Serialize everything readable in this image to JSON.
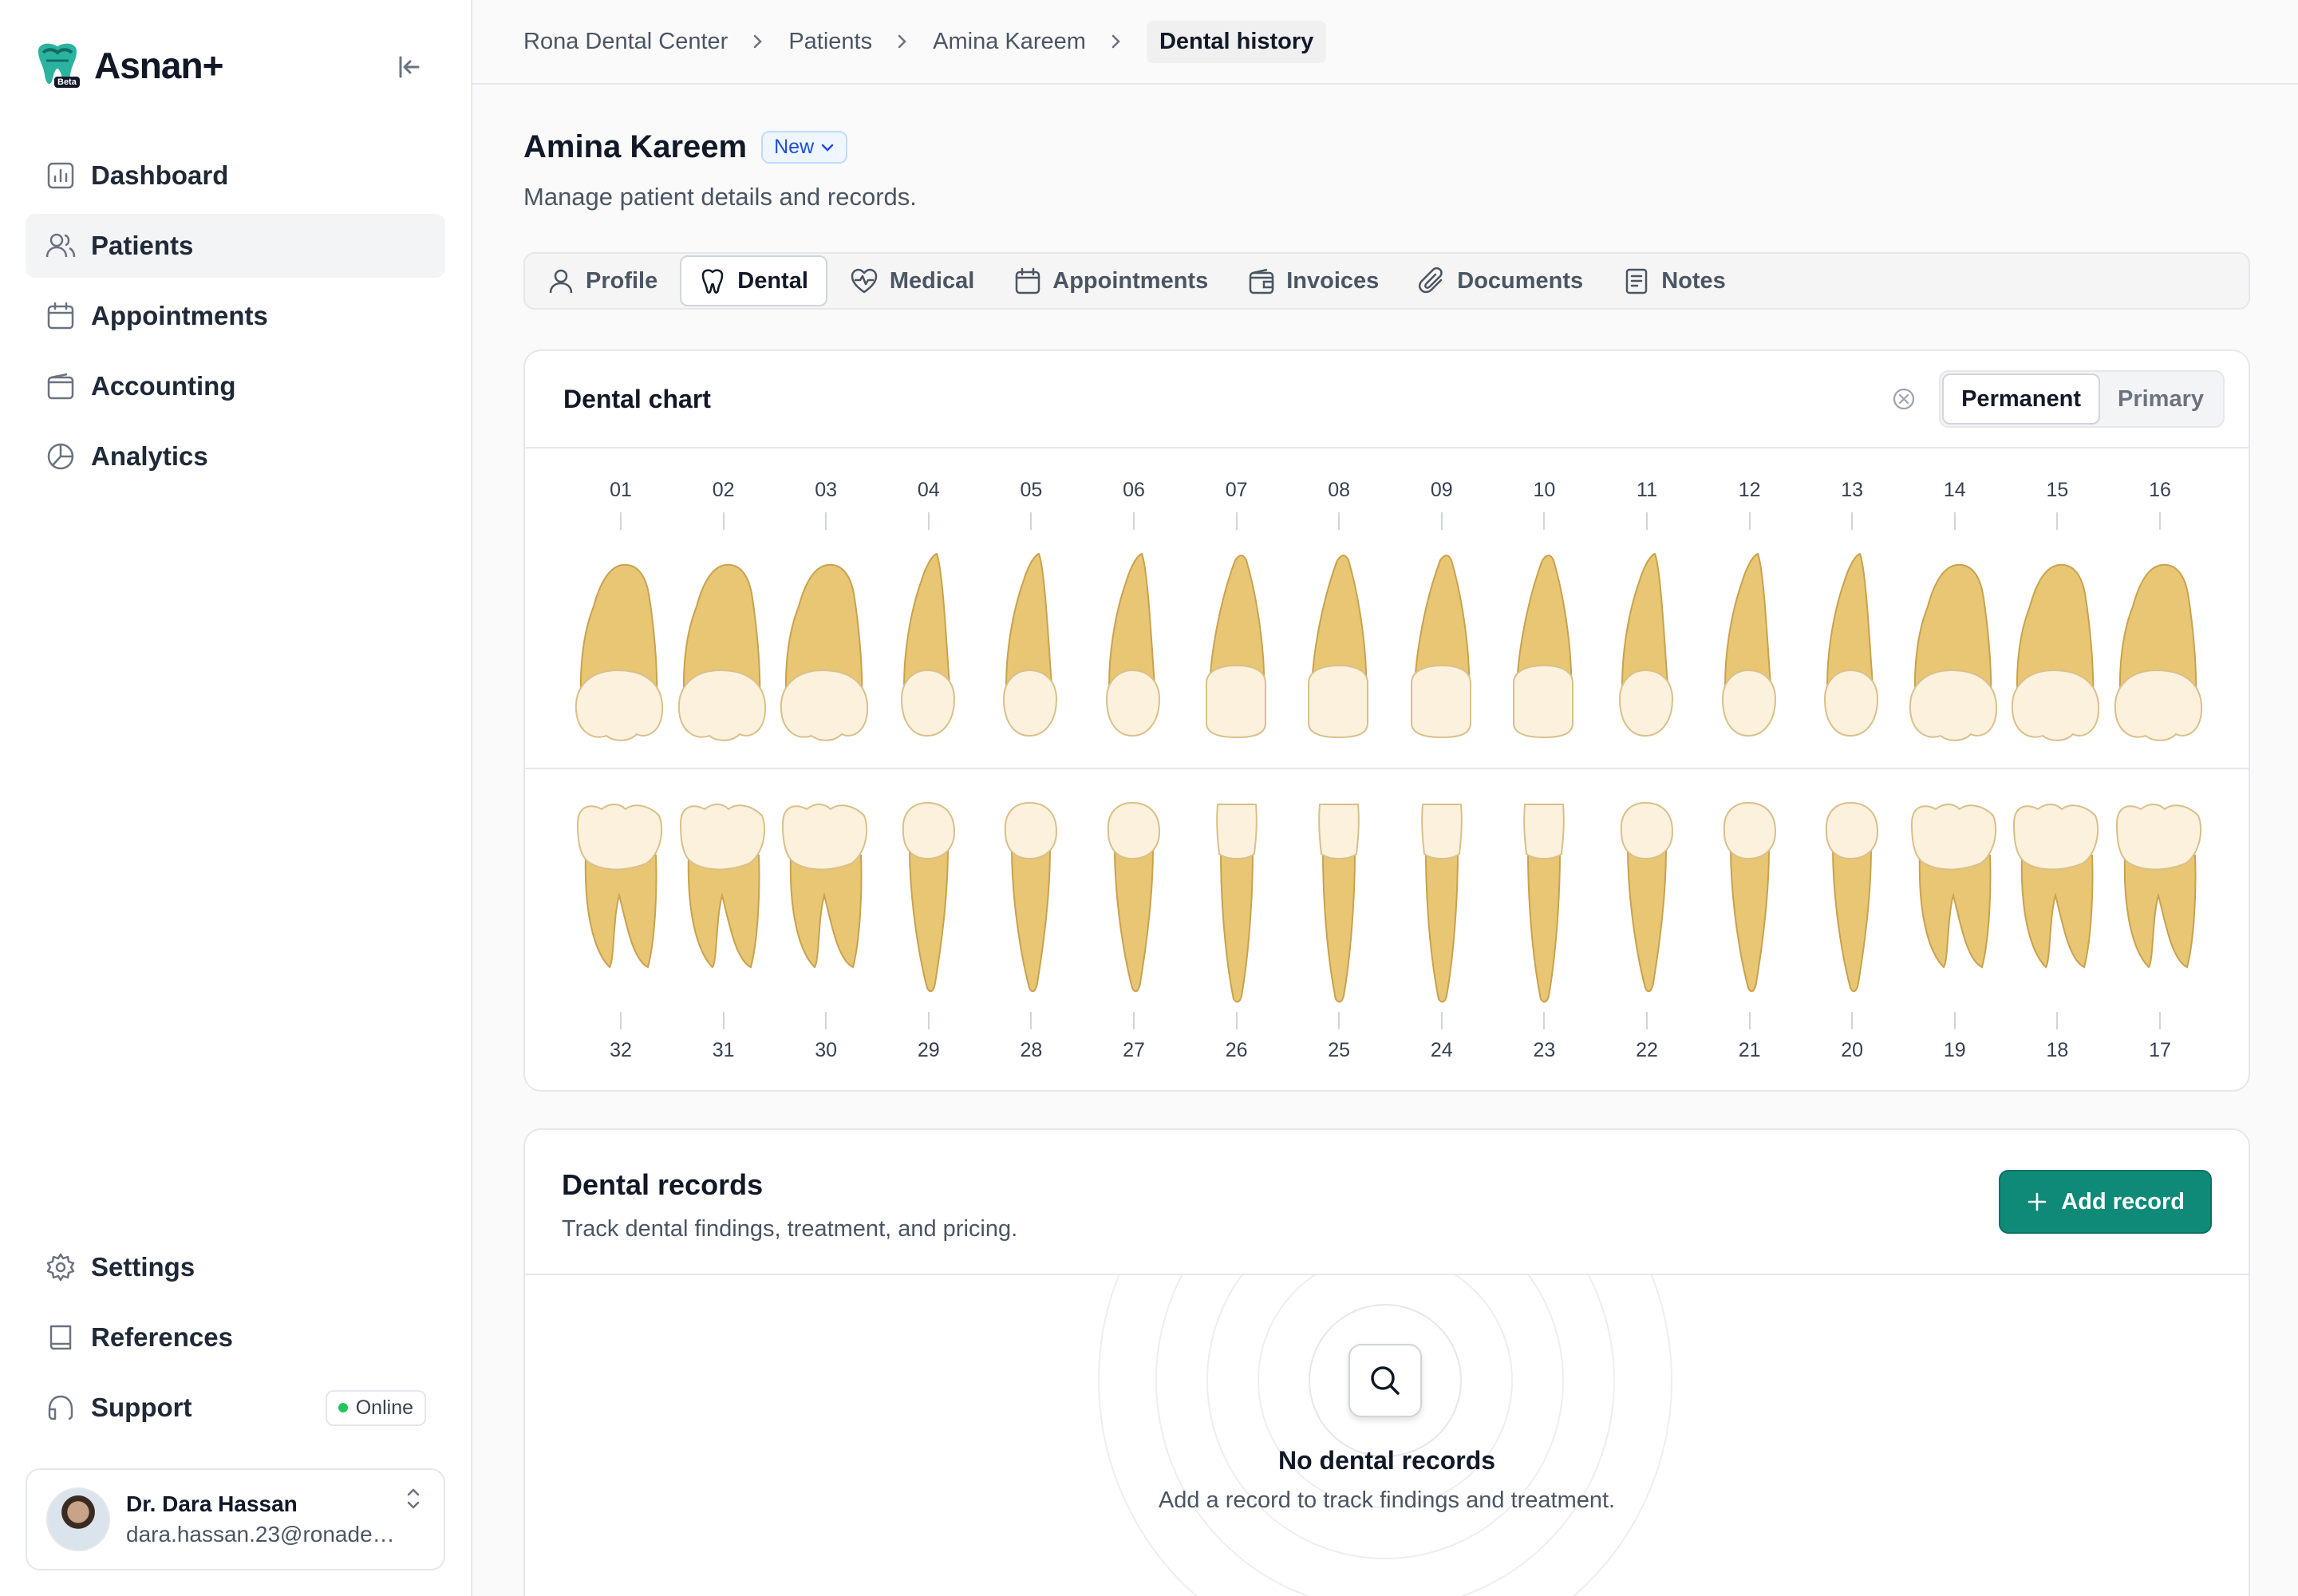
{
  "brand": {
    "name": "Asnan+",
    "badge": "Beta"
  },
  "nav": {
    "items": [
      {
        "label": "Dashboard",
        "icon": "chart-bar-icon"
      },
      {
        "label": "Patients",
        "icon": "users-icon",
        "active": true
      },
      {
        "label": "Appointments",
        "icon": "calendar-icon"
      },
      {
        "label": "Accounting",
        "icon": "wallet-icon"
      },
      {
        "label": "Analytics",
        "icon": "pie-chart-icon"
      }
    ],
    "bottom": [
      {
        "label": "Settings",
        "icon": "gear-icon"
      },
      {
        "label": "References",
        "icon": "book-icon"
      },
      {
        "label": "Support",
        "icon": "headset-icon",
        "badge": "Online"
      }
    ]
  },
  "user": {
    "name": "Dr. Dara Hassan",
    "email": "dara.hassan.23@ronadent..."
  },
  "breadcrumb": [
    "Rona Dental Center",
    "Patients",
    "Amina Kareem",
    "Dental history"
  ],
  "patient": {
    "name": "Amina Kareem",
    "status": "New",
    "subtitle": "Manage patient details and records."
  },
  "tabs": [
    {
      "label": "Profile",
      "icon": "user-icon"
    },
    {
      "label": "Dental",
      "icon": "tooth-icon",
      "active": true
    },
    {
      "label": "Medical",
      "icon": "heart-pulse-icon"
    },
    {
      "label": "Appointments",
      "icon": "calendar-icon"
    },
    {
      "label": "Invoices",
      "icon": "wallet-icon"
    },
    {
      "label": "Documents",
      "icon": "paperclip-icon"
    },
    {
      "label": "Notes",
      "icon": "note-icon"
    }
  ],
  "dental_chart": {
    "title": "Dental chart",
    "dentition_options": [
      "Permanent",
      "Primary"
    ],
    "selected": "Permanent",
    "upper_teeth": [
      "01",
      "02",
      "03",
      "04",
      "05",
      "06",
      "07",
      "08",
      "09",
      "10",
      "11",
      "12",
      "13",
      "14",
      "15",
      "16"
    ],
    "lower_teeth": [
      "32",
      "31",
      "30",
      "29",
      "28",
      "27",
      "26",
      "25",
      "24",
      "23",
      "22",
      "21",
      "20",
      "19",
      "18",
      "17"
    ]
  },
  "records": {
    "title": "Dental records",
    "subtitle": "Track dental findings, treatment, and pricing.",
    "add_label": "Add record",
    "empty_title": "No dental records",
    "empty_subtitle": "Add a record to track findings and treatment."
  },
  "colors": {
    "accent": "#0f8a78",
    "tooth_root": "#e8c673",
    "tooth_crown": "#fbf1dc",
    "online": "#22c55e"
  }
}
